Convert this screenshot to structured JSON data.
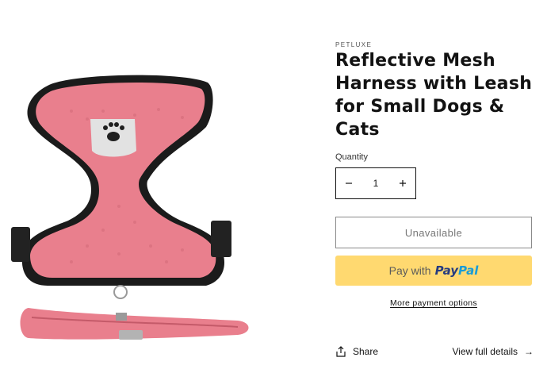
{
  "product": {
    "vendor": "PETLUXE",
    "title": "Reflective Mesh Harness with Leash for Small Dogs & Cats",
    "image_alt": "pink-mesh-harness-with-leash-image",
    "colors": {
      "harness": "#e97f8d",
      "trim": "#1b1b1b",
      "paypal_bg": "#ffd970"
    }
  },
  "quantity": {
    "label": "Quantity",
    "value": "1",
    "decrease_icon": "minus-icon",
    "increase_icon": "plus-icon"
  },
  "buttons": {
    "unavailable": "Unavailable",
    "paypal_prefix": "Pay with",
    "paypal_brand_1": "Pay",
    "paypal_brand_2": "Pal",
    "more_options": "More payment options"
  },
  "footer": {
    "share": "Share",
    "share_icon": "share-icon",
    "view_details": "View full details",
    "arrow_icon": "arrow-right-icon"
  }
}
